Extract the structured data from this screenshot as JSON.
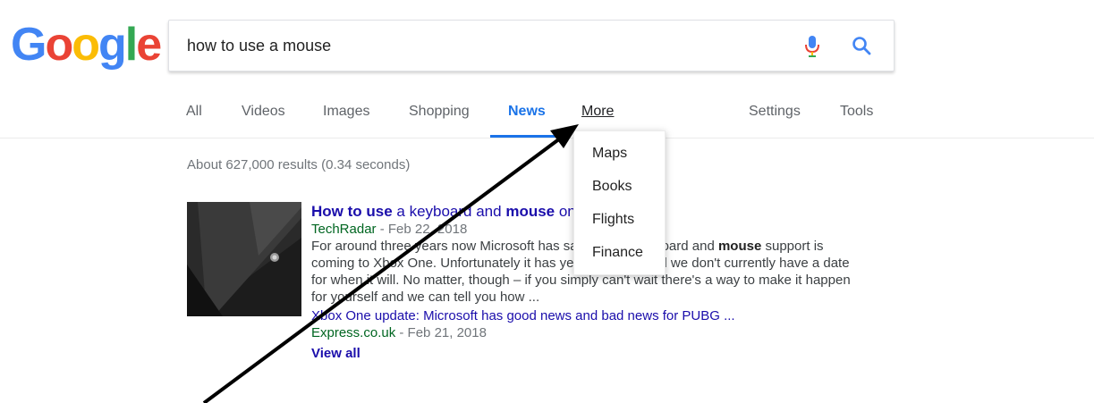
{
  "logo": {
    "letters": [
      "G",
      "o",
      "o",
      "g",
      "l",
      "e"
    ],
    "colors": [
      "#4285F4",
      "#EA4335",
      "#FBBC05",
      "#4285F4",
      "#34A853",
      "#EA4335"
    ]
  },
  "search": {
    "query": "how to use a mouse"
  },
  "tabs": [
    {
      "label": "All"
    },
    {
      "label": "Videos"
    },
    {
      "label": "Images"
    },
    {
      "label": "Shopping"
    },
    {
      "label": "News"
    },
    {
      "label": "More"
    },
    {
      "label": "Settings"
    },
    {
      "label": "Tools"
    }
  ],
  "active_tab": "News",
  "result_stats": "About 627,000 results (0.34 seconds)",
  "news_card": {
    "title_bold_1": "How to use",
    "title_plain_1": " a keyboard and ",
    "title_bold_2": "mouse",
    "title_plain_2": " on Xbox One",
    "source": "TechRadar",
    "date": " - Feb 22, 2018",
    "snippet_1": "For around three years now Microsoft has said official keyboard and ",
    "snippet_bold": "mouse",
    "snippet_2": " support is coming to Xbox One. Unfortunately it has yet to happen and we don't currently have a date for when it will. No matter, though – if you simply can't wait there's a way to make it happen for yourself and we can tell you how ...",
    "related_title": "Xbox One update: Microsoft has good news and bad news for PUBG ...",
    "related_source": "Express.co.uk",
    "related_date": " - Feb 21, 2018",
    "view_all": "View all"
  },
  "more_menu": {
    "items": [
      "Maps",
      "Books",
      "Flights",
      "Finance"
    ]
  },
  "colors": {
    "accent_blue": "#1a73e8",
    "link_blue": "#1a0dab",
    "source_green": "#006621"
  }
}
